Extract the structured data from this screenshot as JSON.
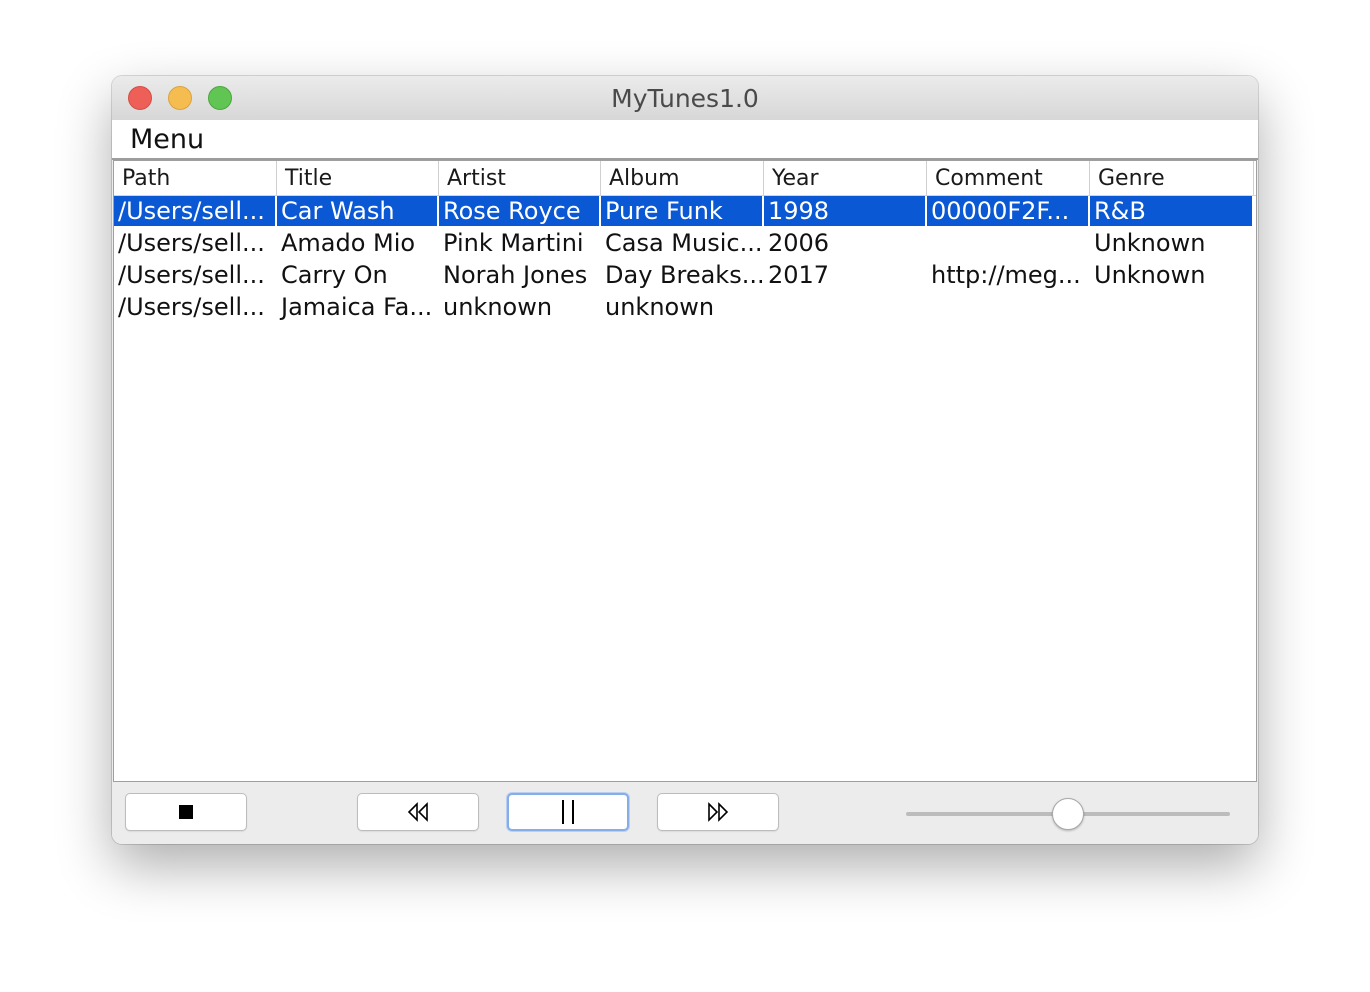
{
  "window": {
    "title": "MyTunes1.0"
  },
  "menubar": {
    "items": [
      {
        "label": "Menu"
      }
    ]
  },
  "table": {
    "columns": [
      "Path",
      "Title",
      "Artist",
      "Album",
      "Year",
      "Comment",
      "Genre"
    ],
    "rows": [
      {
        "selected": true,
        "cells": [
          "/Users/sell...",
          "Car Wash",
          "Rose Royce",
          "Pure Funk",
          "1998",
          " 00000F2F...",
          "R&B"
        ]
      },
      {
        "selected": false,
        "cells": [
          "/Users/sell...",
          "Amado Mio",
          "Pink Martini",
          "Casa Music...",
          "2006",
          "",
          "Unknown"
        ]
      },
      {
        "selected": false,
        "cells": [
          "/Users/sell...",
          "Carry On",
          "Norah Jones",
          "Day Breaks...",
          "2017",
          "http://meg...",
          "Unknown"
        ]
      },
      {
        "selected": false,
        "cells": [
          "/Users/sell...",
          "Jamaica Fa...",
          "unknown",
          "unknown",
          "",
          "",
          ""
        ]
      }
    ]
  },
  "controls": {
    "buttons": [
      {
        "name": "stop-button",
        "icon": "stop-icon"
      },
      {
        "name": "previous-button",
        "icon": "rewind-icon"
      },
      {
        "name": "pause-button",
        "icon": "pause-icon",
        "focused": true
      },
      {
        "name": "next-button",
        "icon": "fast-forward-icon"
      }
    ],
    "volume": {
      "value": 0.5
    }
  },
  "colors": {
    "selection": "#0b58d4",
    "close": "#ee5f57",
    "minimize": "#f5bd4f",
    "maximize": "#61c554"
  }
}
